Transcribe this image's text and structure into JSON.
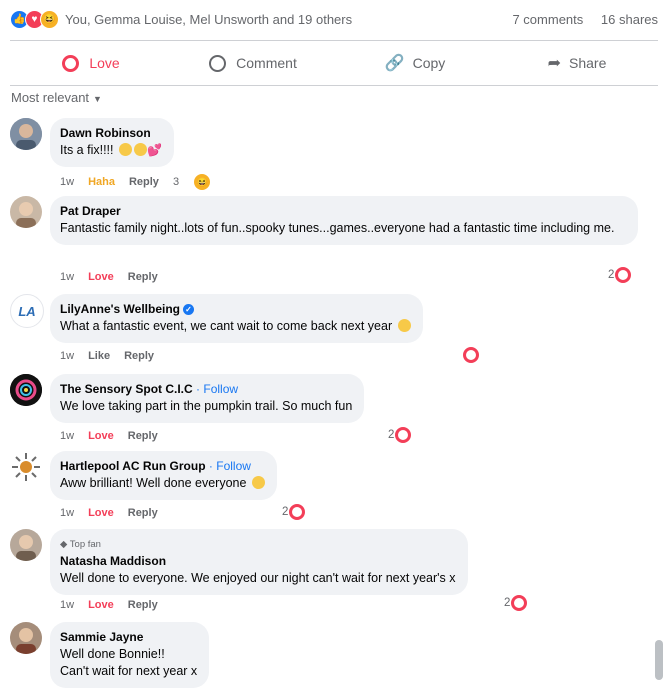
{
  "summary": {
    "reaction_icons": [
      "like-icon",
      "love-icon",
      "haha-icon"
    ],
    "text": "You, Gemma Louise, Mel Unsworth and 19 others",
    "comments": "7 comments",
    "shares": "16 shares"
  },
  "actions": {
    "love": "Love",
    "comment": "Comment",
    "copy": "Copy",
    "share": "Share"
  },
  "sort": {
    "label": "Most relevant"
  },
  "comments": [
    {
      "name": "Dawn Robinson",
      "text": "Its a fix!!!!",
      "time": "1w",
      "reaction": "Haha",
      "reply": "Reply",
      "count": "3"
    },
    {
      "name": "Pat Draper",
      "text": "Fantastic family night..lots of fun..spooky tunes...games..everyone had a fantastic time including me.",
      "time": "1w",
      "reaction": "Love",
      "reply": "Reply",
      "count": "2"
    },
    {
      "name": "LilyAnne's Wellbeing",
      "text": "What a fantastic event, we cant wait to come back next year",
      "time": "1w",
      "reaction": "Like",
      "reply": "Reply",
      "count": ""
    },
    {
      "name": "The Sensory Spot C.I.C",
      "follow": "Follow",
      "text": "We love taking part in the pumpkin trail. So much fun",
      "time": "1w",
      "reaction": "Love",
      "reply": "Reply",
      "count": "2"
    },
    {
      "name": "Hartlepool AC Run Group",
      "follow": "Follow",
      "text": "Aww brilliant! Well done everyone",
      "time": "1w",
      "reaction": "Love",
      "reply": "Reply",
      "count": "2"
    },
    {
      "badge": "Top fan",
      "name": "Natasha Maddison",
      "text": "Well done to everyone. We enjoyed our night can't wait for next year's x",
      "time": "1w",
      "reaction": "Love",
      "reply": "Reply",
      "count": "2"
    },
    {
      "name": "Sammie Jayne",
      "line1": "Well done Bonnie!!",
      "line2": "Can't wait for next year x"
    }
  ],
  "avatars": {
    "lilyanne_text": "LA"
  },
  "colors": {
    "love": "#f33e58",
    "link": "#1877f2",
    "bubble": "#f0f2f5",
    "haha": "#f7b125"
  }
}
